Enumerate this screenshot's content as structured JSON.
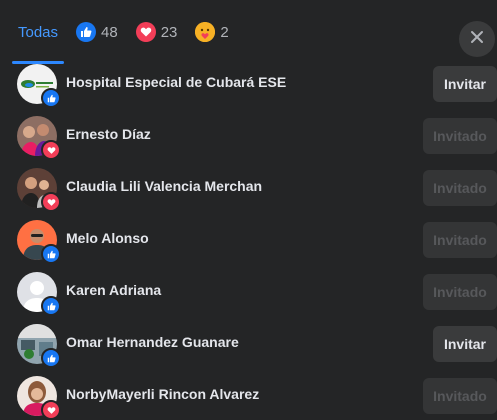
{
  "tabs": [
    {
      "label": "Todas",
      "active": true
    },
    {
      "icon": "like-reaction-icon",
      "count": "48"
    },
    {
      "icon": "love-reaction-icon",
      "count": "23"
    },
    {
      "icon": "care-reaction-icon",
      "count": "2"
    }
  ],
  "colors": {
    "like": "#1877f2",
    "love": "#f33e58",
    "care": "#f7b125",
    "accent": "#2d88ff"
  },
  "people": [
    {
      "name": "Hospital Especial de Cubará ESE",
      "reaction": "like",
      "action": "Invitar",
      "state": "invite"
    },
    {
      "name": "Ernesto Díaz",
      "reaction": "love",
      "action": "Invitado",
      "state": "invited"
    },
    {
      "name": "Claudia Lili Valencia Merchan",
      "reaction": "love",
      "action": "Invitado",
      "state": "invited"
    },
    {
      "name": "Melo Alonso",
      "reaction": "like",
      "action": "Invitado",
      "state": "invited"
    },
    {
      "name": "Karen Adriana",
      "reaction": "like",
      "action": "Invitado",
      "state": "invited"
    },
    {
      "name": "Omar Hernandez Guanare",
      "reaction": "like",
      "action": "Invitar",
      "state": "invite"
    },
    {
      "name": "NorbyMayerli Rincon Alvarez",
      "reaction": "love",
      "action": "Invitado",
      "state": "invited"
    }
  ]
}
